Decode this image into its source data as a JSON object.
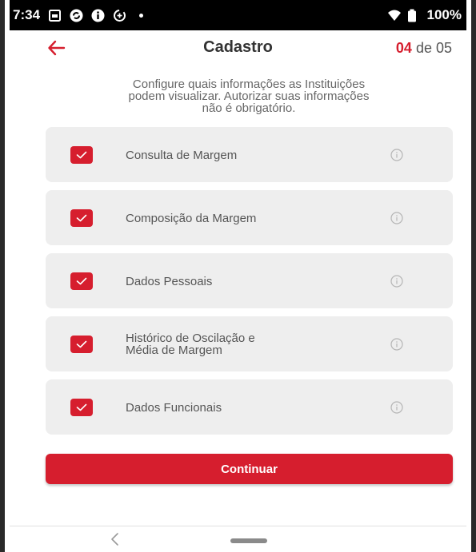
{
  "status_bar": {
    "time": "7:34",
    "battery": "100%",
    "icons": [
      "sim-icon",
      "sync-icon",
      "info-circle-icon",
      "data-saver-icon",
      "notification-dot-icon",
      "wifi-icon",
      "battery-icon"
    ]
  },
  "header": {
    "back_icon": "arrow-left-icon",
    "title": "Cadastro",
    "step_current": "04",
    "step_total": " de 05"
  },
  "description": {
    "line1": "Configure quais informações as Instituições",
    "line2": "podem visualizar. Autorizar suas informações",
    "line3": "não é obrigatório."
  },
  "options": [
    {
      "label_line1": "Consulta de Margem",
      "label_line2": "",
      "checked": true
    },
    {
      "label_line1": "Composição da Margem",
      "label_line2": "",
      "checked": true
    },
    {
      "label_line1": "Dados Pessoais",
      "label_line2": "",
      "checked": true
    },
    {
      "label_line1": "Histórico de Oscilação e",
      "label_line2": "Média de Margem",
      "checked": true
    },
    {
      "label_line1": "Dados Funcionais",
      "label_line2": "",
      "checked": true
    }
  ],
  "continue_button": {
    "label": "Continuar"
  },
  "nav_bar": {
    "back_glyph": "<"
  },
  "colors": {
    "accent": "#d61e2e",
    "card_background": "#eeeeee",
    "title_text": "#333333",
    "body_text": "#666666"
  }
}
